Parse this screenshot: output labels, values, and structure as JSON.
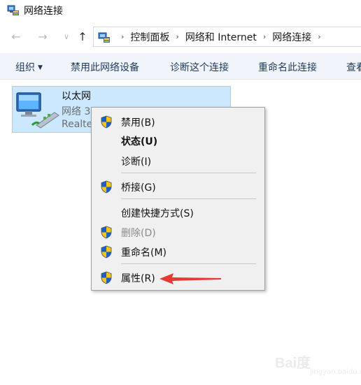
{
  "window": {
    "title": "网络连接"
  },
  "nav": {
    "back": "←",
    "forward": "→",
    "recent": "∨",
    "up": "↑"
  },
  "address": {
    "crumbs": [
      "控制面板",
      "网络和 Internet",
      "网络连接"
    ],
    "separator": "›"
  },
  "toolbar": {
    "organize": "组织",
    "organize_caret": "▼",
    "disable": "禁用此网络设备",
    "diagnose": "诊断这个连接",
    "rename": "重命名此连接",
    "view": "查看"
  },
  "connection": {
    "name": "以太网",
    "status": "网络 3",
    "device": "Realtek"
  },
  "context_menu": {
    "items": [
      {
        "label": "禁用(B)",
        "shield": true
      },
      {
        "label": "状态(U)",
        "bold": true
      },
      {
        "label": "诊断(I)"
      },
      {
        "label": "桥接(G)",
        "shield": true
      },
      {
        "label": "创建快捷方式(S)"
      },
      {
        "label": "删除(D)",
        "shield": true,
        "disabled": true
      },
      {
        "label": "重命名(M)",
        "shield": true
      },
      {
        "label": "属性(R)",
        "shield": true
      }
    ]
  },
  "annotation": {
    "arrow_color": "#e53935",
    "points_to": "属性(R)"
  },
  "watermark": {
    "brand": "Bai度",
    "sub": "jingyan.baidu.com"
  },
  "colors": {
    "selection_bg": "#cce8ff",
    "selection_border": "#99d1ff",
    "toolbar_bg": "#f1f5fb",
    "toolbar_text": "#1e395b",
    "menu_bg": "#f0f0f0",
    "shield_blue": "#1f5fc2",
    "shield_yellow": "#f5c518"
  }
}
